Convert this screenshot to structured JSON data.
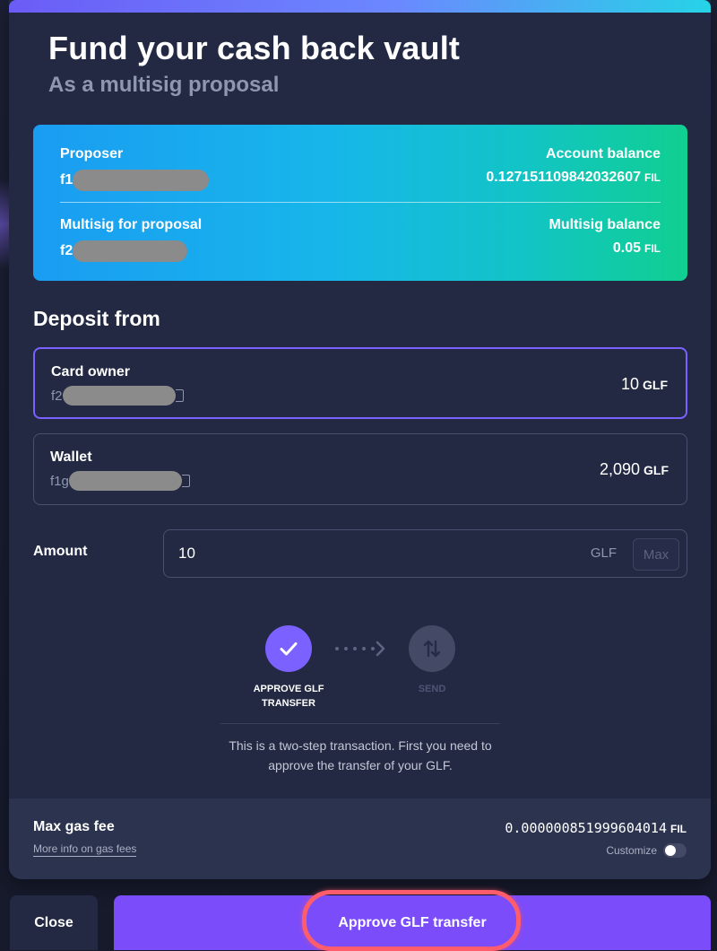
{
  "header": {
    "title": "Fund your cash back vault",
    "subtitle": "As a multisig proposal"
  },
  "accounts_card": {
    "proposer_label": "Proposer",
    "proposer_address_prefix": "f1",
    "account_balance_label": "Account balance",
    "account_balance_value": "0.127151109842032607",
    "account_balance_unit": "FIL",
    "multisig_label": "Multisig for proposal",
    "multisig_address_prefix": "f2",
    "multisig_balance_label": "Multisig balance",
    "multisig_balance_value": "0.05",
    "multisig_balance_unit": "FIL"
  },
  "deposit": {
    "heading": "Deposit from",
    "options": [
      {
        "name": "Card owner",
        "address_prefix": "f2",
        "value": "10",
        "unit": "GLF",
        "selected": true
      },
      {
        "name": "Wallet",
        "address_prefix": "f1g",
        "value": "2,090",
        "unit": "GLF",
        "selected": false
      }
    ]
  },
  "amount": {
    "label": "Amount",
    "value": "10",
    "unit": "GLF",
    "max_label": "Max"
  },
  "steps": {
    "step1_label": "APPROVE GLF TRANSFER",
    "step2_label": "SEND",
    "note": "This is a two-step transaction. First you need to approve the transfer of your GLF."
  },
  "gas": {
    "label": "Max gas fee",
    "link": "More info on gas fees",
    "value": "0.000000851999604014",
    "unit": "FIL",
    "customize_label": "Customize"
  },
  "footer": {
    "close_label": "Close",
    "primary_label": "Approve GLF transfer"
  },
  "colors": {
    "accent": "#7b4dfa",
    "step_done": "#7b61ff",
    "highlight": "#ff5d6c",
    "card_gradient_start": "#1a9cf2",
    "card_gradient_end": "#10cf90"
  }
}
